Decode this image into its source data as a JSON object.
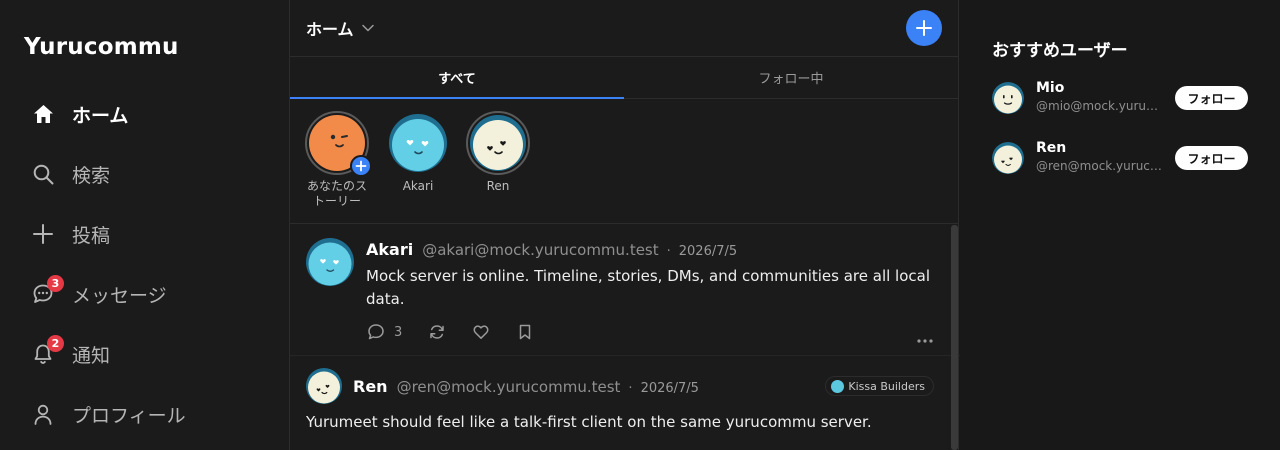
{
  "app": {
    "title": "Yurucommu"
  },
  "sidebar": {
    "items": [
      {
        "label": "ホーム",
        "icon": "home-icon",
        "active": true
      },
      {
        "label": "検索",
        "icon": "search-icon"
      },
      {
        "label": "投稿",
        "icon": "plus-icon"
      },
      {
        "label": "メッセージ",
        "icon": "chat-icon",
        "badge": "3"
      },
      {
        "label": "通知",
        "icon": "bell-icon",
        "badge": "2"
      },
      {
        "label": "プロフィール",
        "icon": "user-icon"
      }
    ]
  },
  "header": {
    "title": "ホーム"
  },
  "tabs": [
    {
      "label": "すべて",
      "active": true
    },
    {
      "label": "フォロー中"
    }
  ],
  "stories": [
    {
      "name_line1": "あなたのス",
      "name_line2": "トーリー",
      "avatar": "orange-wink-avatar"
    },
    {
      "name": "Akari",
      "avatar": "blue-heart-eyes-avatar"
    },
    {
      "name": "Ren",
      "avatar": "cream-heart-avatar"
    }
  ],
  "posts": [
    {
      "name": "Akari",
      "handle": "@akari@mock.yurucommu.test",
      "date": "2026/7/5",
      "text_line1": "Mock server is online. Timeline, stories, DMs, and communities are all local",
      "text_line2": "data.",
      "reply_count": "3"
    },
    {
      "name": "Ren",
      "handle": "@ren@mock.yurucommu.test",
      "date": "2026/7/5",
      "community": "Kissa Builders",
      "text": "Yurumeet should feel like a talk-first client on the same yurucommu server."
    }
  ],
  "recommended": {
    "title": "おすすめユーザー",
    "users": [
      {
        "name": "Mio",
        "handle": "@mio@mock.yurucommu.test",
        "follow_label": "フォロー"
      },
      {
        "name": "Ren",
        "handle": "@ren@mock.yurucommu.test",
        "follow_label": "フォロー"
      }
    ]
  },
  "colors": {
    "accent": "#3b82f6",
    "badge": "#e53946",
    "background": "#181818"
  }
}
